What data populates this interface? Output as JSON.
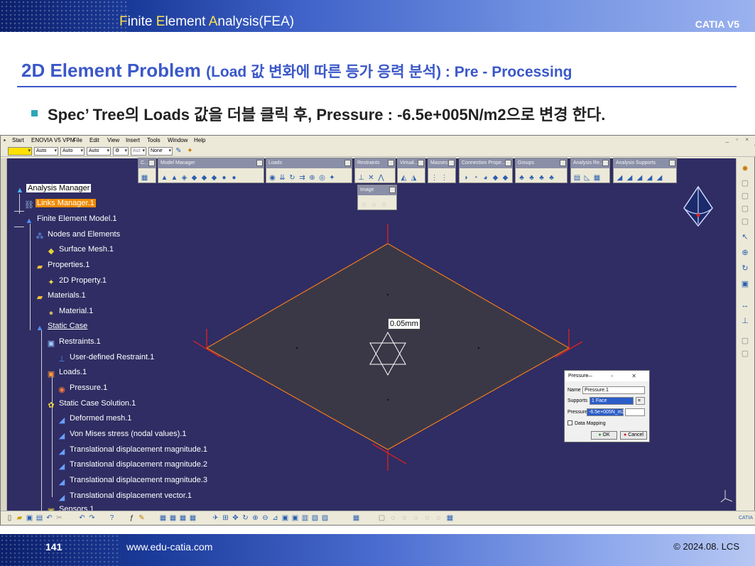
{
  "header": {
    "title_parts": [
      "F",
      "inite ",
      "E",
      "lement ",
      "A",
      "nalysis(FEA)"
    ],
    "brand": "CATIA V5"
  },
  "slide": {
    "title_main": "2D Element Problem ",
    "title_sub": "(Load 값 변화에 따른 등가 응력 분석) : Pre - Processing",
    "bullet": "Spec’ Tree의 Loads 값을 더블 클릭 후, Pressure : -6.5e+005N/m2으로 변경 한다.",
    "bullet_color": "#2aa7b8",
    "title_color": "#3b58c8"
  },
  "catia": {
    "menu": [
      "Start",
      "ENOVIA V5 VPM",
      "File",
      "Edit",
      "View",
      "Insert",
      "Tools",
      "Window",
      "Help"
    ],
    "window_controls": "_ ▫ ×",
    "std_combos": [
      "",
      "Auto",
      "Auto",
      "Auto",
      "",
      "Aut",
      "None"
    ],
    "toolbars": [
      {
        "name": "C..."
      },
      {
        "name": "Model Manager"
      },
      {
        "name": "Loads"
      },
      {
        "name": "Restraints"
      },
      {
        "name": "Virtual..."
      },
      {
        "name": "Masses"
      },
      {
        "name": "Connection Prope..."
      },
      {
        "name": "Groups"
      },
      {
        "name": "Analysis Re..."
      },
      {
        "name": "Analysis Supports"
      },
      {
        "name": "Image"
      }
    ],
    "tree": [
      {
        "label": "Analysis Manager",
        "icon": "analysis-manager-icon",
        "state": "selected"
      },
      {
        "label": "Links Manager.1",
        "icon": "links-manager-icon",
        "state": "highlight"
      },
      {
        "label": "Finite Element Model.1",
        "icon": "fem-model-icon",
        "state": ""
      },
      {
        "label": "Nodes and Elements",
        "icon": "nodes-icon",
        "state": ""
      },
      {
        "label": "Surface Mesh.1",
        "icon": "mesh-icon",
        "state": ""
      },
      {
        "label": "Properties.1",
        "icon": "folder-icon",
        "state": ""
      },
      {
        "label": "2D Property.1",
        "icon": "property-icon",
        "state": ""
      },
      {
        "label": "Materials.1",
        "icon": "folder-icon",
        "state": ""
      },
      {
        "label": "Material.1",
        "icon": "material-icon",
        "state": ""
      },
      {
        "label": "Static Case",
        "icon": "static-case-icon",
        "state": "underline"
      },
      {
        "label": "Restraints.1",
        "icon": "restraints-icon",
        "state": ""
      },
      {
        "label": "User-defined Restraint.1",
        "icon": "restraint-icon",
        "state": ""
      },
      {
        "label": "Loads.1",
        "icon": "loads-icon",
        "state": ""
      },
      {
        "label": "Pressure.1",
        "icon": "pressure-icon",
        "state": ""
      },
      {
        "label": "Static Case Solution.1",
        "icon": "solution-icon",
        "state": ""
      },
      {
        "label": "Deformed mesh.1",
        "icon": "image-icon",
        "state": ""
      },
      {
        "label": "Von Mises stress (nodal values).1",
        "icon": "image-icon",
        "state": ""
      },
      {
        "label": "Translational displacement magnitude.1",
        "icon": "image-icon",
        "state": ""
      },
      {
        "label": "Translational displacement magnitude.2",
        "icon": "image-icon",
        "state": ""
      },
      {
        "label": "Translational displacement magnitude.3",
        "icon": "image-icon",
        "state": ""
      },
      {
        "label": "Translational displacement vector.1",
        "icon": "image-icon",
        "state": ""
      },
      {
        "label": "Sensors.1",
        "icon": "sensors-icon",
        "state": ""
      }
    ],
    "dimension_label": "0.05mm",
    "viewport_color": "#2f2d63",
    "part_color": "#3a3847",
    "edge_color": "#f07a1a",
    "restraint_color": "#e02020"
  },
  "dialog": {
    "title": "Pressure",
    "controls": "— ▫ ✕",
    "name_label": "Name",
    "name_value": "Pressure.1",
    "supports_label": "Supports",
    "supports_value": "1 Face",
    "pressure_label": "Pressure",
    "pressure_value": "-6.5e+005N_m2",
    "data_mapping": "Data Mapping",
    "ok": "OK",
    "cancel": "Cancel"
  },
  "footer": {
    "page": "141",
    "website": "www.edu-catia.com",
    "copyright": "© 2024.08. LCS"
  }
}
